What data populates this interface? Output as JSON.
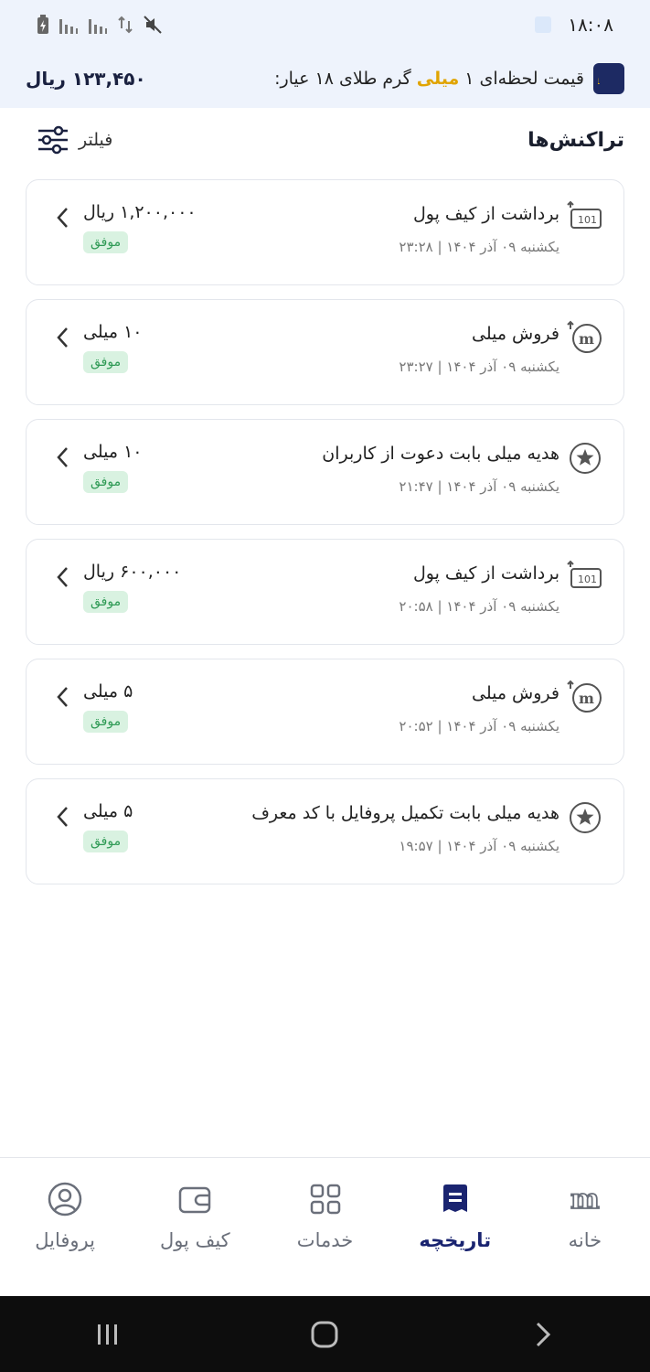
{
  "status_bar": {
    "time": "۱۸:۰۸"
  },
  "price_bar": {
    "label_before": "قیمت لحظه‌ای ۱ ",
    "label_highlight": "میلی",
    "label_after": " گرم طلای ۱۸ عیار:",
    "value": "۱۲۳,۴۵۰ ریال"
  },
  "header": {
    "title": "تراکنش‌ها",
    "filter_label": "فیلتر"
  },
  "transactions": [
    {
      "title": "برداشت از کیف پول",
      "date": "یکشنبه ۰۹ آذر ۱۴۰۴ | ۲۳:۲۸",
      "amount": "۱,۲۰۰,۰۰۰ ریال",
      "status": "موفق",
      "icon": "cash-withdraw-icon"
    },
    {
      "title": "فروش میلی",
      "date": "یکشنبه ۰۹ آذر ۱۴۰۴ | ۲۳:۲۷",
      "amount": "۱۰ میلی",
      "status": "موفق",
      "icon": "milli-sell-icon"
    },
    {
      "title": "هدیه میلی بابت دعوت از کاربران",
      "date": "یکشنبه ۰۹ آذر ۱۴۰۴ | ۲۱:۴۷",
      "amount": "۱۰ میلی",
      "status": "موفق",
      "icon": "star-gift-icon"
    },
    {
      "title": "برداشت از کیف پول",
      "date": "یکشنبه ۰۹ آذر ۱۴۰۴ | ۲۰:۵۸",
      "amount": "۶۰۰,۰۰۰ ریال",
      "status": "موفق",
      "icon": "cash-withdraw-icon"
    },
    {
      "title": "فروش میلی",
      "date": "یکشنبه ۰۹ آذر ۱۴۰۴ | ۲۰:۵۲",
      "amount": "۵ میلی",
      "status": "موفق",
      "icon": "milli-sell-icon"
    },
    {
      "title": "هدیه میلی بابت تکمیل پروفایل با کد معرف",
      "date": "یکشنبه ۰۹ آذر ۱۴۰۴ | ۱۹:۵۷",
      "amount": "۵ میلی",
      "status": "موفق",
      "icon": "star-gift-icon"
    }
  ],
  "bottom_nav": {
    "items": [
      {
        "label": "خانه",
        "icon": "milli-home-icon"
      },
      {
        "label": "تاریخچه",
        "icon": "history-icon",
        "active": true
      },
      {
        "label": "خدمات",
        "icon": "services-grid-icon"
      },
      {
        "label": "کیف پول",
        "icon": "wallet-icon"
      },
      {
        "label": "پروفایل",
        "icon": "profile-icon"
      }
    ]
  },
  "colors": {
    "accent": "#1a2470",
    "highlight": "#e0a400",
    "success_bg": "#d9f2e1",
    "success_text": "#2f9a55"
  }
}
